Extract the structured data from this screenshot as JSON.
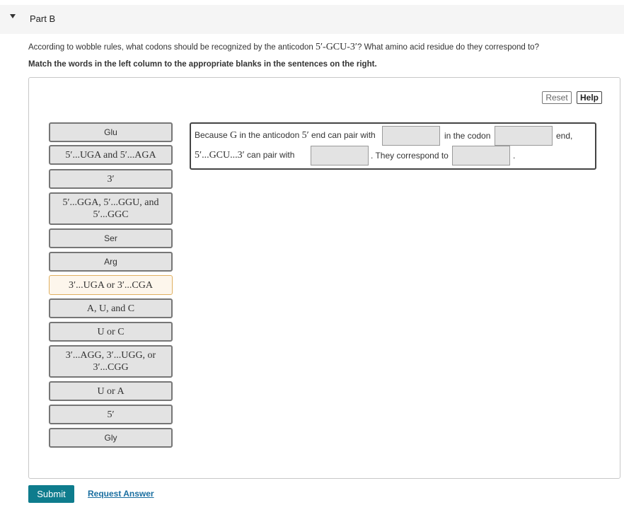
{
  "part": {
    "title": "Part B"
  },
  "question": {
    "prefix": "According to wobble rules, what codons should be recognized by the anticodon ",
    "anticodon": "5′-GCU-3′",
    "suffix": "? What amino acid residue do they correspond to?"
  },
  "instruction": "Match the words in the left column to the appropriate blanks in the sentences on the right.",
  "toolbar": {
    "reset_label": "Reset",
    "help_label": "Help"
  },
  "tiles": [
    {
      "text": "Glu"
    },
    {
      "text": "5′...UGA and 5′...AGA"
    },
    {
      "text": "3′"
    },
    {
      "text": "5′...GGA, 5′...GGU, and 5′...GGC"
    },
    {
      "text": "Ser"
    },
    {
      "text": "Arg"
    },
    {
      "text": "3′...UGA or 3′...CGA"
    },
    {
      "text": "A, U, and C"
    },
    {
      "text": "U or C"
    },
    {
      "text": "3′...AGG, 3′...UGG, or 3′...CGG"
    },
    {
      "text": "U or A"
    },
    {
      "text": "5′"
    },
    {
      "text": "Gly"
    }
  ],
  "sentence": {
    "because": "Because ",
    "g": "G",
    "in_anticodon": " in the anticodon ",
    "five_prime": "5′",
    "end_can_pair": " end can pair with",
    "in_the_codon": "in the codon",
    "end_comma": "end,",
    "gcu": "5′...GCU...3′",
    "can_pair_with": " can pair with",
    "they_correspond": ". They correspond to",
    "period": "."
  },
  "actions": {
    "submit_label": "Submit",
    "request_answer_label": "Request Answer"
  },
  "colors": {
    "submit_bg": "#0e7c8d",
    "link": "#1a6ea0",
    "tile_bg": "#e3e3e3",
    "selected_border": "#e0b060"
  }
}
